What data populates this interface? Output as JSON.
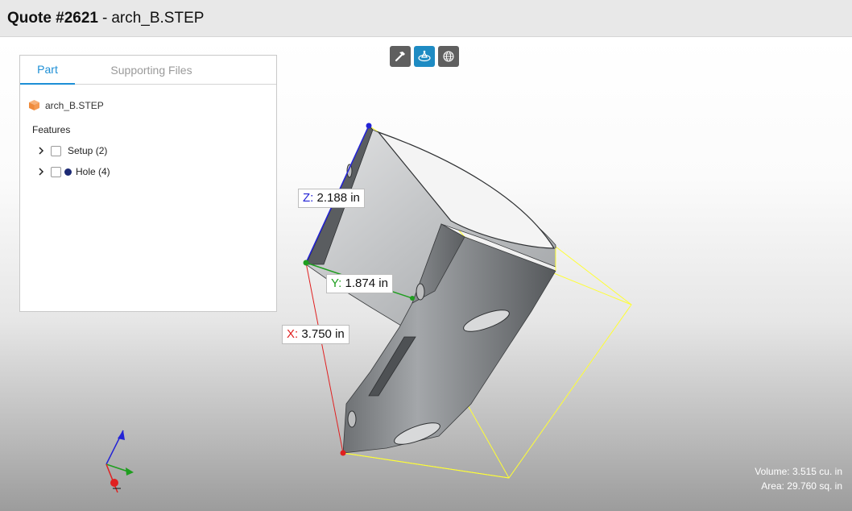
{
  "window": {
    "quote": "Quote #2621",
    "separator": "-",
    "filename": "arch_B.STEP"
  },
  "toolbar": {
    "buttons": [
      {
        "icon": "hammer-icon",
        "active": false
      },
      {
        "icon": "part-view-icon",
        "active": true
      },
      {
        "icon": "globe-icon",
        "active": false
      }
    ]
  },
  "panel": {
    "tabs": [
      "Part",
      "Supporting Files"
    ],
    "active_tab": "Part",
    "file": {
      "icon": "part-cube-icon",
      "name": "arch_B.STEP"
    },
    "features_title": "Features",
    "features": [
      {
        "label": "Setup (2)",
        "has_dot": false
      },
      {
        "label": "Hole (4)",
        "has_dot": true,
        "dot_color": "#1c2a74"
      }
    ]
  },
  "dimensions": {
    "z": {
      "axis": "Z:",
      "value": "2.188 in",
      "color": "#2323d6"
    },
    "y": {
      "axis": "Y:",
      "value": "1.874 in",
      "color": "#1f9e1f"
    },
    "x": {
      "axis": "X:",
      "value": "3.750 in",
      "color": "#e02020"
    }
  },
  "stats": {
    "volume": "Volume: 3.515 cu. in",
    "area": "Area: 29.760 sq. in"
  },
  "colors": {
    "accent": "#1d8fd6",
    "bounding_box": "#ffff33",
    "part_gray": "#8b8e91"
  }
}
